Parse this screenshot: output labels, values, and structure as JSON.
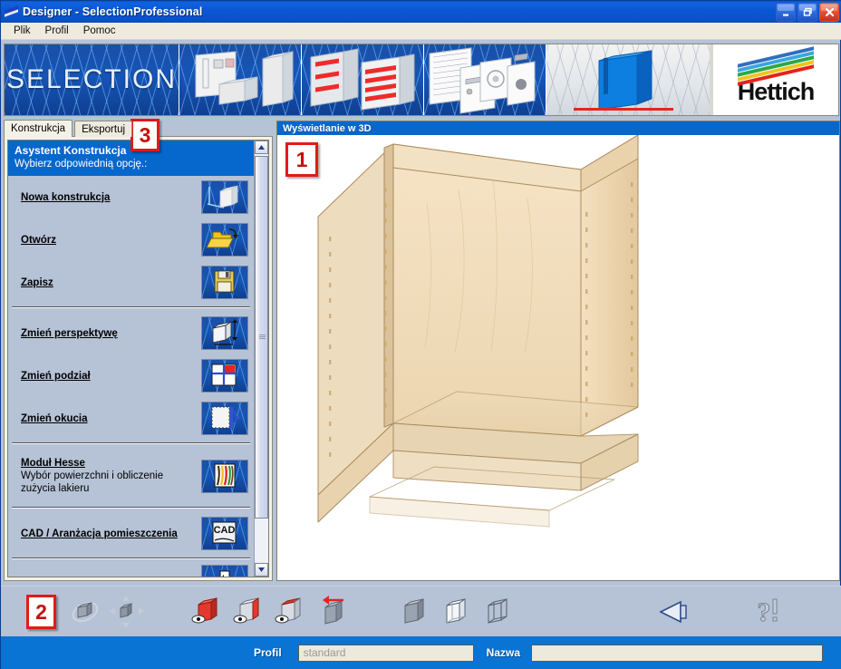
{
  "window": {
    "title": "Designer  -  SelectionProfessional",
    "icon": "designer-app-icon",
    "buttons": {
      "minimize": "minimize-icon",
      "restore": "restore-icon",
      "close": "close-icon"
    }
  },
  "menubar": {
    "items": [
      {
        "label": "Plik"
      },
      {
        "label": "Profil"
      },
      {
        "label": "Pomoc"
      }
    ]
  },
  "banner": {
    "brand_word": "SELECTION",
    "logo_text": "Hettich",
    "logo_stripe_colors": [
      "#2f6fc0",
      "#3aa6dd",
      "#2aa84a",
      "#f0c419",
      "#e2231a"
    ],
    "cells": [
      {
        "name": "selection-wordmark"
      },
      {
        "name": "cabinet-panels-art"
      },
      {
        "name": "drawer-system-art"
      },
      {
        "name": "hardware-fittings-art"
      },
      {
        "name": "blue-cabinet-art"
      }
    ]
  },
  "sidebar": {
    "tabs": [
      {
        "label": "Konstrukcja",
        "active": true
      },
      {
        "label": "Eksportuj",
        "active": false
      }
    ],
    "assistant": {
      "title": "Asystent Konstrukcja",
      "subtitle": "Wybierz odpowiednią opcję.:"
    },
    "items": [
      {
        "label": "Nowa konstrukcja",
        "icon": "new-construction-icon",
        "sub": ""
      },
      {
        "label": "Otwórz",
        "icon": "open-folder-icon",
        "sub": ""
      },
      {
        "label": "Zapisz",
        "icon": "save-diskette-icon",
        "sub": ""
      },
      {
        "label": "Zmień perspektywę",
        "icon": "change-perspective-icon",
        "sub": ""
      },
      {
        "label": "Zmień podział",
        "icon": "change-division-icon",
        "sub": ""
      },
      {
        "label": "Zmień okucia",
        "icon": "change-fittings-icon",
        "sub": ""
      },
      {
        "label": "Moduł Hesse",
        "icon": "hesse-module-icon",
        "sub": "Wybór powierzchni i obliczenie zużycia lakieru"
      },
      {
        "label": "CAD / Aranżacja pomieszczenia",
        "icon": "cad-room-layout-icon",
        "sub": ""
      }
    ],
    "scrollbar": {
      "up": "scroll-up-arrow-icon",
      "down": "scroll-down-arrow-icon"
    }
  },
  "view3d": {
    "title": "Wyświetlanie w 3D",
    "content": "cabinet-carcass-3d-render"
  },
  "toolbar": {
    "items": [
      {
        "name": "select-object-icon"
      },
      {
        "name": "rotate-view-icon"
      },
      {
        "name": "pan-move-icon"
      },
      {
        "name": "hide-front-face-icon"
      },
      {
        "name": "hide-side-face-icon"
      },
      {
        "name": "hide-top-face-icon"
      },
      {
        "name": "move-element-icon"
      },
      {
        "name": "solid-view-icon"
      },
      {
        "name": "hidden-line-view-icon"
      },
      {
        "name": "wireframe-view-icon"
      },
      {
        "name": "back-arrow-icon"
      },
      {
        "name": "help-icon"
      }
    ]
  },
  "statusbar": {
    "profil_label": "Profil",
    "profil_value": "standard",
    "nazwa_label": "Nazwa",
    "nazwa_value": ""
  },
  "annotations": [
    {
      "id": "1",
      "target": "view3d-panel"
    },
    {
      "id": "2",
      "target": "toolbar"
    },
    {
      "id": "3",
      "target": "sidebar-tabs"
    }
  ],
  "colors": {
    "title_blue": "#0a57d2",
    "accent_blue": "#0667cc",
    "status_blue": "#0a74d4",
    "panel_bg": "#b6c2d6",
    "marker_red": "#e01b17"
  }
}
